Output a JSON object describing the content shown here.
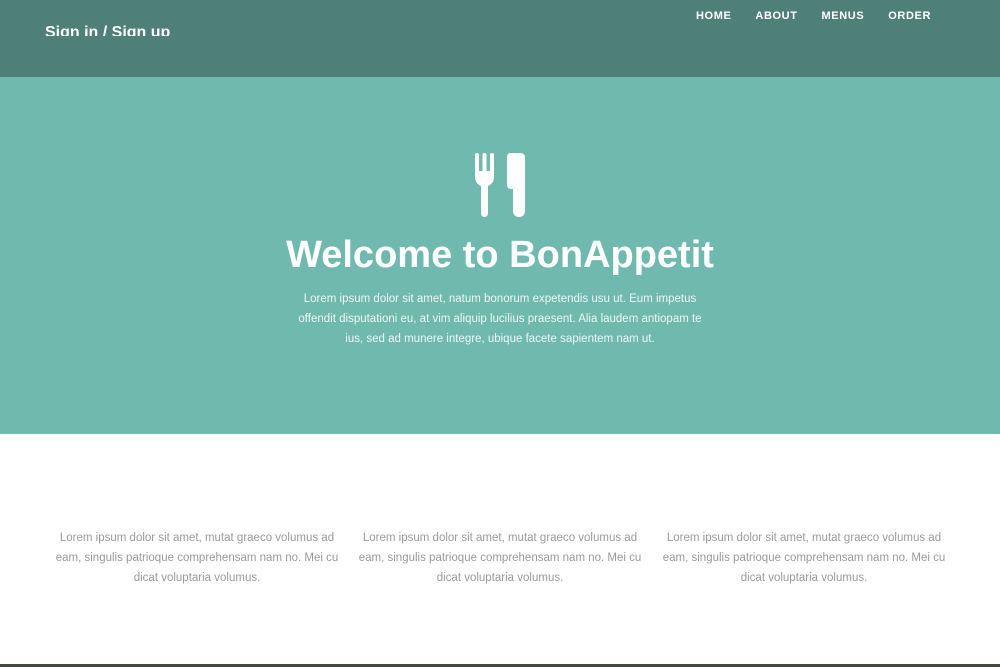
{
  "header": {
    "brand": "Sign in / Sign up",
    "nav": [
      {
        "label": "HOME"
      },
      {
        "label": "ABOUT"
      },
      {
        "label": "MENUS"
      },
      {
        "label": "ORDER"
      }
    ]
  },
  "hero": {
    "icon": "fork-knife-icon",
    "title": "Welcome to BonAppetit",
    "text": "Lorem ipsum dolor sit amet, natum bonorum expetendis usu ut. Eum impetus offendit disputationi eu, at vim aliquip lucilius praesent. Alia laudem antiopam te ius, sed ad munere integre, ubique facete sapientem nam ut."
  },
  "features": [
    {
      "text": "Lorem ipsum dolor sit amet, mutat graeco volumus ad eam, singulis patrioque comprehensam nam no. Mei cu dicat voluptaria volumus."
    },
    {
      "text": "Lorem ipsum dolor sit amet, mutat graeco volumus ad eam, singulis patrioque comprehensam nam no. Mei cu dicat voluptaria volumus."
    },
    {
      "text": "Lorem ipsum dolor sit amet, mutat graeco volumus ad eam, singulis patrioque comprehensam nam no. Mei cu dicat voluptaria volumus."
    }
  ],
  "colors": {
    "header": "#4f8078",
    "hero": "#6fb9af",
    "text_light": "#ffffff",
    "feature_text": "#9a9a9a"
  }
}
